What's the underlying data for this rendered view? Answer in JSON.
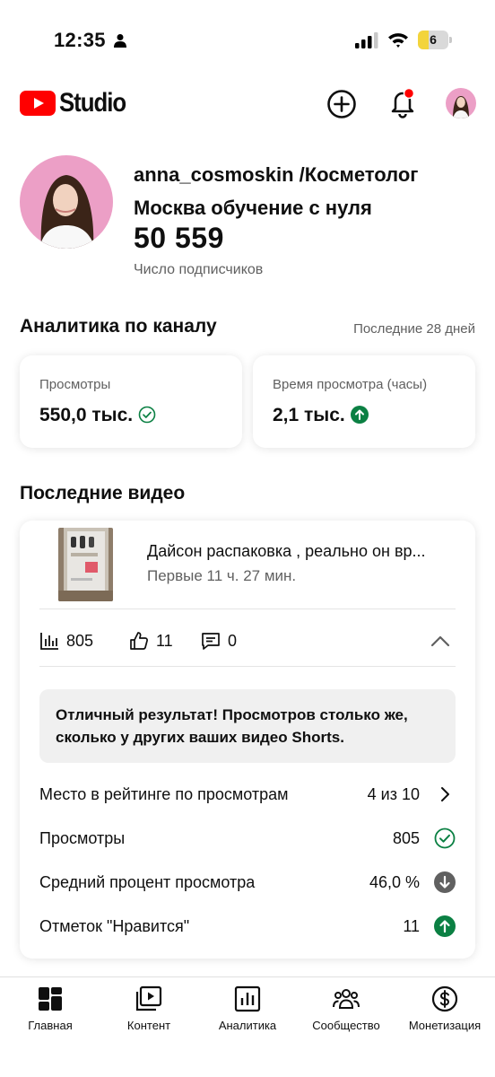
{
  "status_bar": {
    "time": "12:35",
    "battery": "6",
    "icons": [
      "person-icon",
      "signal-icon",
      "wifi-icon",
      "battery-icon"
    ]
  },
  "app_bar": {
    "brand": "Studio",
    "icons": [
      "youtube-logo-icon",
      "add-icon",
      "bell-icon"
    ],
    "brand_color": "#ff0000",
    "notification_dot_color": "#ff0000"
  },
  "channel": {
    "name": "anna_cosmoskin /Косметолог Москва обучение с нуля",
    "subscribers": "50 559",
    "subscribers_label": "Число подписчиков"
  },
  "analytics": {
    "title": "Аналитика по каналу",
    "period": "Последние 28 дней",
    "metrics": [
      {
        "label": "Просмотры",
        "value": "550,0 тыс.",
        "badge": "check-circle-icon"
      },
      {
        "label": "Время просмотра (часы)",
        "value": "2,1 тыс.",
        "badge": "arrow-up-circle-icon"
      }
    ]
  },
  "recent_videos": {
    "title": "Последние видео",
    "video": {
      "title": "Дайсон распаковка , реально он вр...",
      "age": "Первые 11 ч. 27 мин.",
      "views": "805",
      "likes": "11",
      "comments": "0"
    },
    "message": "Отличный результат! Просмотров столько же, сколько у других ваших видео Shorts.",
    "rows": [
      {
        "label": "Место в рейтинге по просмотрам",
        "value": "4 из 10",
        "icon": "chevron-right-icon"
      },
      {
        "label": "Просмотры",
        "value": "805",
        "icon": "check-circle-icon"
      },
      {
        "label": "Средний процент просмотра",
        "value": "46,0 %",
        "icon": "arrow-down-circle-icon"
      },
      {
        "label": "Отметок \"Нравится\"",
        "value": "11",
        "icon": "arrow-up-circle-icon"
      }
    ]
  },
  "bottom_nav": {
    "items": [
      {
        "label": "Главная",
        "icon": "dashboard-icon"
      },
      {
        "label": "Контент",
        "icon": "content-icon"
      },
      {
        "label": "Аналитика",
        "icon": "analytics-icon"
      },
      {
        "label": "Сообщество",
        "icon": "community-icon"
      },
      {
        "label": "Монетизация",
        "icon": "monetization-icon"
      }
    ]
  },
  "colors": {
    "positive": "#0b8043",
    "neutral_badge": "#606060",
    "text": "#0f0f0f",
    "secondary_text": "#606060"
  }
}
